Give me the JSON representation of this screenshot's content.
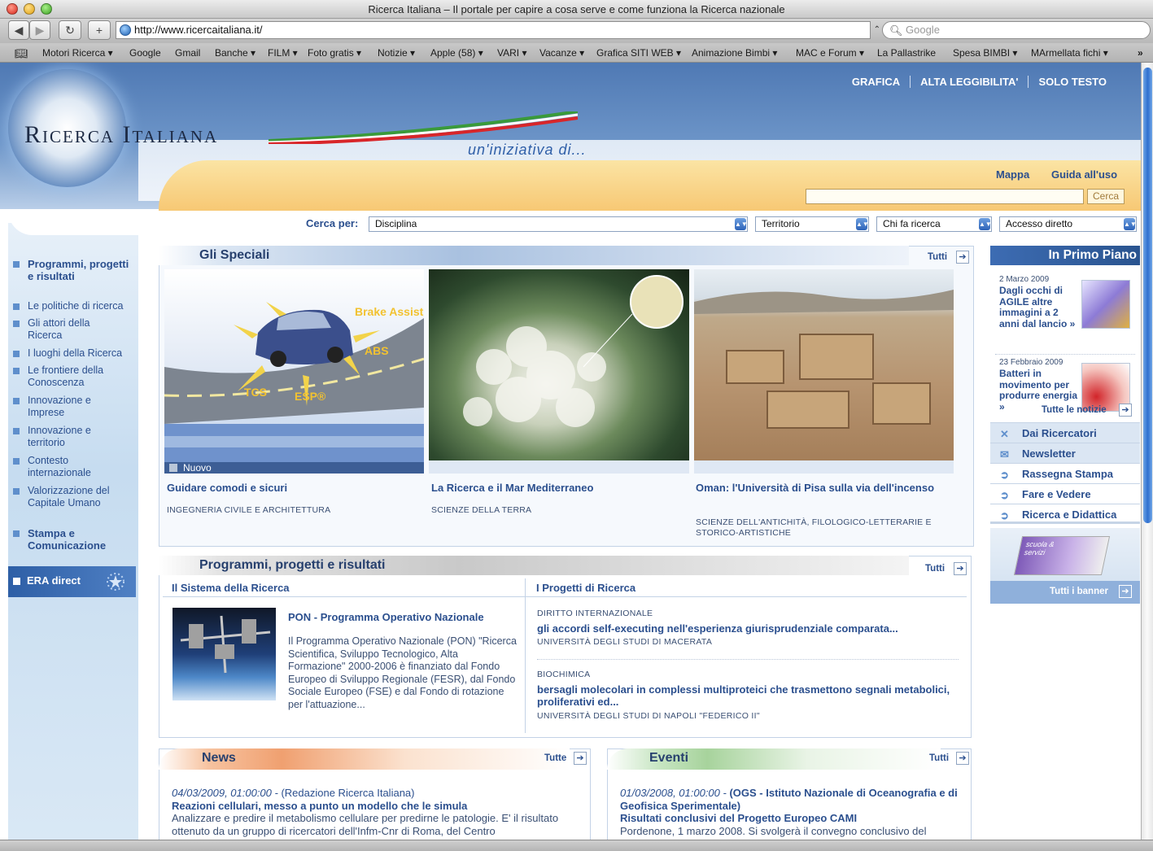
{
  "browser": {
    "title": "Ricerca Italiana – Il portale per capire a cosa serve e come funziona la Ricerca nazionale",
    "url": "http://www.ricercaitaliana.it/",
    "search_placeholder": "Google",
    "bookmarks": [
      "Motori Ricerca ▾",
      "Google",
      "Gmail",
      "Banche ▾",
      "FILM ▾",
      "Foto gratis ▾",
      "Notizie ▾",
      "Apple (58) ▾",
      "VARI ▾",
      "Vacanze ▾",
      "Grafica SITI WEB ▾",
      "Animazione Bimbi ▾",
      "MAC e Forum ▾",
      "La Pallastrike",
      "Spesa BIMBI ▾",
      "MArmellata fichi ▾"
    ]
  },
  "header": {
    "logo": "Ricerca Italiana",
    "tagline": "un'iniziativa di...",
    "top_links": [
      "GRAFICA",
      "ALTA LEGGIBILITA'",
      "SOLO TESTO"
    ],
    "mappa": "Mappa",
    "guida": "Guida all'uso",
    "search_button": "Cerca"
  },
  "search_by": {
    "label": "Cerca per:",
    "selects": [
      "Disciplina",
      "Territorio",
      "Chi fa ricerca",
      "Accesso diretto"
    ]
  },
  "sidebar": {
    "items": [
      {
        "label": "Programmi, progetti e risultati",
        "bold": true
      },
      {
        "label": "Le politiche di ricerca"
      },
      {
        "label": "Gli attori della Ricerca"
      },
      {
        "label": "I luoghi della Ricerca"
      },
      {
        "label": "Le frontiere della Conoscenza"
      },
      {
        "label": "Innovazione e Imprese"
      },
      {
        "label": "Innovazione e territorio"
      },
      {
        "label": "Contesto internazionale"
      },
      {
        "label": "Valorizzazione del Capitale Umano"
      },
      {
        "label": "Stampa e Comunicazione",
        "bold": true
      }
    ],
    "era": "ERA direct"
  },
  "speciali": {
    "title": "Gli Speciali",
    "tutti": "Tutti",
    "nuovo": "Nuovo",
    "car_labels": [
      "Brake Assist",
      "ABS",
      "TCS",
      "ESP®"
    ],
    "items": [
      {
        "title": "Guidare comodi e sicuri",
        "category": "INGEGNERIA CIVILE E ARCHITETTURA"
      },
      {
        "title": "La Ricerca e il Mar Mediterraneo",
        "category": "SCIENZE DELLA TERRA"
      },
      {
        "title": "Oman: l'Università di Pisa sulla via dell'incenso",
        "category": "SCIENZE DELL'ANTICHITÀ, FILOLOGICO-LETTERARIE E STORICO-ARTISTICHE"
      }
    ]
  },
  "primo_piano": {
    "title": "In Primo Piano",
    "news": [
      {
        "date": "2 Marzo 2009",
        "title": "Dagli occhi di AGILE altre immagini a 2 anni dal lancio »"
      },
      {
        "date": "23 Febbraio 2009",
        "title": "Batteri in movimento per produrre energia »"
      }
    ],
    "all_news": "Tutte le notizie",
    "links": [
      "Dai Ricercatori",
      "Newsletter",
      "Rassegna Stampa",
      "Fare e Vedere",
      "Ricerca e Didattica"
    ],
    "banner_text": "scuola & servizi",
    "all_banners": "Tutti i banner"
  },
  "programmi": {
    "title": "Programmi, progetti e risultati",
    "tutti": "Tutti",
    "left_head": "Il Sistema della Ricerca",
    "right_head": "I Progetti di Ricerca",
    "pon_title": "PON - Programma Operativo Nazionale",
    "pon_text": "Il Programma Operativo Nazionale (PON) \"Ricerca Scientifica, Sviluppo Tecnologico, Alta Formazione\" 2000-2006 è finanziato dal Fondo Europeo di Sviluppo Regionale (FESR), dal Fondo Sociale Europeo (FSE) e dal Fondo di rotazione per l'attuazione...",
    "projects": [
      {
        "category": "DIRITTO INTERNAZIONALE",
        "title": "gli accordi self-executing nell'esperienza giurisprudenziale comparata...",
        "uni": "UNIVERSITÀ DEGLI STUDI DI MACERATA"
      },
      {
        "category": "BIOCHIMICA",
        "title": "bersagli molecolari in complessi multiproteici che trasmettono segnali metabolici, proliferativi ed...",
        "uni": "UNIVERSITÀ DEGLI STUDI DI NAPOLI \"FEDERICO II\""
      }
    ]
  },
  "news": {
    "title": "News",
    "tutte": "Tutte",
    "meta": "04/03/2009, 01:00:00 - ",
    "source": "(Redazione Ricerca Italiana)",
    "headline": "Reazioni cellulari, messo a punto un modello che le simula",
    "text": "Analizzare e predire il metabolismo cellulare per predirne le patologie. E' il risultato ottenuto da un gruppo di ricercatori dell'Infm-Cnr di Roma, del Centro"
  },
  "eventi": {
    "title": "Eventi",
    "tutti": "Tutti",
    "meta": "01/03/2008, 01:00:00 - ",
    "source": "(OGS - Istituto Nazionale di Oceanografia e di Geofisica Sperimentale)",
    "headline": "Risultati conclusivi del Progetto Europeo CAMI",
    "text": "Pordenone, 1 marzo 2008. Si svolgerà il convegno conclusivo del"
  }
}
